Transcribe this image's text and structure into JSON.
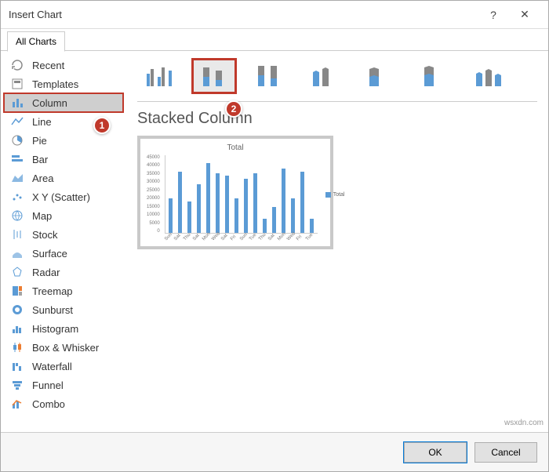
{
  "dialog": {
    "title": "Insert Chart",
    "help": "?",
    "close": "✕"
  },
  "tabs": {
    "all_charts": "All Charts"
  },
  "sidebar": {
    "items": [
      {
        "key": "recent",
        "label": "Recent"
      },
      {
        "key": "templates",
        "label": "Templates"
      },
      {
        "key": "column",
        "label": "Column",
        "selected": true
      },
      {
        "key": "line",
        "label": "Line"
      },
      {
        "key": "pie",
        "label": "Pie"
      },
      {
        "key": "bar",
        "label": "Bar"
      },
      {
        "key": "area",
        "label": "Area"
      },
      {
        "key": "scatter",
        "label": "X Y (Scatter)"
      },
      {
        "key": "map",
        "label": "Map"
      },
      {
        "key": "stock",
        "label": "Stock"
      },
      {
        "key": "surface",
        "label": "Surface"
      },
      {
        "key": "radar",
        "label": "Radar"
      },
      {
        "key": "treemap",
        "label": "Treemap"
      },
      {
        "key": "sunburst",
        "label": "Sunburst"
      },
      {
        "key": "histogram",
        "label": "Histogram"
      },
      {
        "key": "boxwhisker",
        "label": "Box & Whisker"
      },
      {
        "key": "waterfall",
        "label": "Waterfall"
      },
      {
        "key": "funnel",
        "label": "Funnel"
      },
      {
        "key": "combo",
        "label": "Combo"
      }
    ]
  },
  "subtypes": {
    "items": [
      {
        "key": "clustered-column"
      },
      {
        "key": "stacked-column",
        "selected": true
      },
      {
        "key": "100-stacked-column"
      },
      {
        "key": "3d-clustered-column"
      },
      {
        "key": "3d-stacked-column"
      },
      {
        "key": "3d-100-stacked-column"
      },
      {
        "key": "3d-column"
      }
    ]
  },
  "preview": {
    "heading": "Stacked Column",
    "chart_title": "Total",
    "legend_label": "Total"
  },
  "footer": {
    "ok": "OK",
    "cancel": "Cancel"
  },
  "annotations": {
    "badge1": "1",
    "badge2": "2"
  },
  "watermark": "wsxdn.com",
  "chart_data": {
    "type": "bar",
    "title": "Total",
    "ylabel": "",
    "xlabel": "",
    "ylim": [
      0,
      45000
    ],
    "yticks": [
      0,
      5000,
      10000,
      15000,
      20000,
      25000,
      30000,
      35000,
      40000,
      45000
    ],
    "categories": [
      "Sun",
      "Sat",
      "Thu",
      "Sat",
      "Mon",
      "Wed",
      "Sat",
      "Fri",
      "Sun",
      "Tue",
      "Thu",
      "Sat",
      "Mon",
      "Wed",
      "Fri",
      "Tue"
    ],
    "series": [
      {
        "name": "Total",
        "values": [
          20000,
          35000,
          18000,
          28000,
          40000,
          34000,
          33000,
          20000,
          31000,
          34000,
          8000,
          15000,
          37000,
          20000,
          35000,
          8000
        ]
      }
    ],
    "legend": [
      "Total"
    ]
  }
}
